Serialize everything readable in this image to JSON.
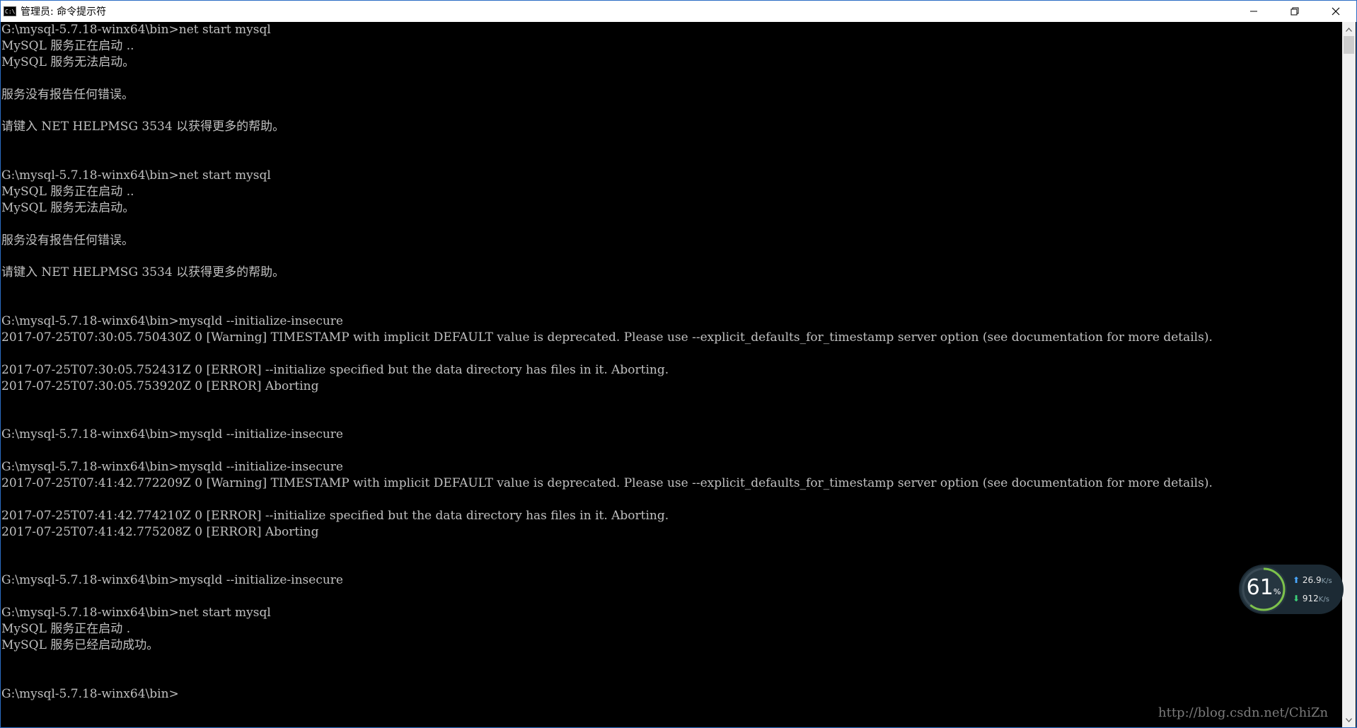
{
  "window": {
    "title": "管理员: 命令提示符",
    "icon_label": "C:\\",
    "minimize_icon": "minimize-icon",
    "restore_icon": "restore-icon",
    "close_icon": "close-icon"
  },
  "console": {
    "lines": [
      "G:\\mysql-5.7.18-winx64\\bin>net start mysql",
      "MySQL 服务正在启动 ..",
      "MySQL 服务无法启动。",
      "",
      "服务没有报告任何错误。",
      "",
      "请键入 NET HELPMSG 3534 以获得更多的帮助。",
      "",
      "",
      "G:\\mysql-5.7.18-winx64\\bin>net start mysql",
      "MySQL 服务正在启动 ..",
      "MySQL 服务无法启动。",
      "",
      "服务没有报告任何错误。",
      "",
      "请键入 NET HELPMSG 3534 以获得更多的帮助。",
      "",
      "",
      "G:\\mysql-5.7.18-winx64\\bin>mysqld --initialize-insecure",
      "2017-07-25T07:30:05.750430Z 0 [Warning] TIMESTAMP with implicit DEFAULT value is deprecated. Please use --explicit_defaults_for_timestamp server option (see documentation for more details).",
      "",
      "2017-07-25T07:30:05.752431Z 0 [ERROR] --initialize specified but the data directory has files in it. Aborting.",
      "2017-07-25T07:30:05.753920Z 0 [ERROR] Aborting",
      "",
      "",
      "G:\\mysql-5.7.18-winx64\\bin>mysqld --initialize-insecure",
      "",
      "G:\\mysql-5.7.18-winx64\\bin>mysqld --initialize-insecure",
      "2017-07-25T07:41:42.772209Z 0 [Warning] TIMESTAMP with implicit DEFAULT value is deprecated. Please use --explicit_defaults_for_timestamp server option (see documentation for more details).",
      "",
      "2017-07-25T07:41:42.774210Z 0 [ERROR] --initialize specified but the data directory has files in it. Aborting.",
      "2017-07-25T07:41:42.775208Z 0 [ERROR] Aborting",
      "",
      "",
      "G:\\mysql-5.7.18-winx64\\bin>mysqld --initialize-insecure",
      "",
      "G:\\mysql-5.7.18-winx64\\bin>net start mysql",
      "MySQL 服务正在启动 .",
      "MySQL 服务已经启动成功。",
      "",
      "",
      "G:\\mysql-5.7.18-winx64\\bin>"
    ]
  },
  "net_widget": {
    "percent": "61",
    "percent_sign": "%",
    "percent_value": 0.61,
    "upload_speed": "26.9",
    "upload_unit": "K/s",
    "download_speed": "912",
    "download_unit": "K/s",
    "gauge_color": "#7dc24b"
  },
  "watermark": "http://blog.csdn.net/ChiZn",
  "colors": {
    "console_bg": "#000000",
    "console_text": "#c0c0c0",
    "titlebar_bg": "#ffffff",
    "window_border": "#2b6cc4"
  }
}
